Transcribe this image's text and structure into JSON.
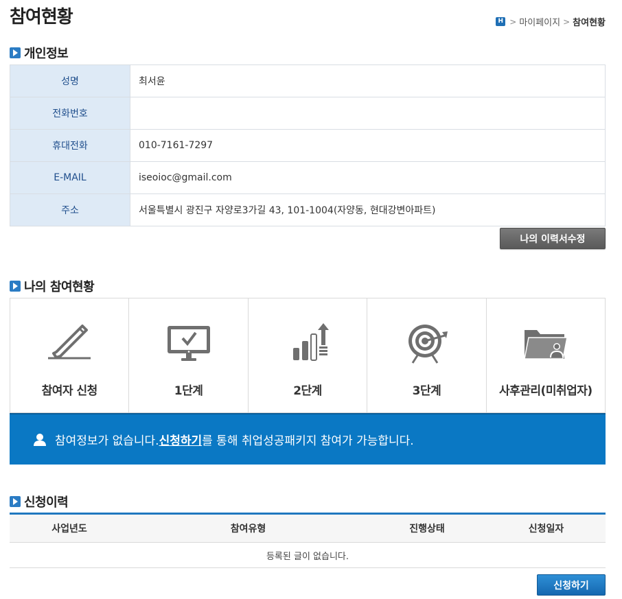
{
  "page": {
    "title": "참여현황"
  },
  "breadcrumb": {
    "home_icon": "H",
    "items": [
      "마이페이지",
      "참여현황"
    ],
    "sep": ">"
  },
  "personal": {
    "title": "개인정보",
    "rows": [
      {
        "label": "성명",
        "value": "최서윤"
      },
      {
        "label": "전화번호",
        "value": ""
      },
      {
        "label": "휴대전화",
        "value": "010-7161-7297"
      },
      {
        "label": "E-MAIL",
        "value": "iseoioc@gmail.com"
      },
      {
        "label": "주소",
        "value": "서울특별시 광진구 자양로3가길 43, 101-1004(자양동, 현대강변아파트)"
      }
    ],
    "edit_button": "나의 이력서수정"
  },
  "participation": {
    "title": "나의 참여현황",
    "steps": [
      {
        "label": "참여자 신청",
        "icon": "pencil-icon"
      },
      {
        "label": "1단계",
        "icon": "monitor-check-icon"
      },
      {
        "label": "2단계",
        "icon": "bar-growth-icon"
      },
      {
        "label": "3단계",
        "icon": "target-icon"
      },
      {
        "label": "사후관리(미취업자)",
        "icon": "folder-user-icon"
      }
    ],
    "notice": {
      "prefix": "참여정보가 없습니다. ",
      "link": "신청하기",
      "suffix": "를 통해 취업성공패키지 참여가 가능합니다."
    }
  },
  "history": {
    "title": "신청이력",
    "columns": [
      "사업년도",
      "참여유형",
      "진행상태",
      "신청일자"
    ],
    "empty_message": "등록된 글이 없습니다.",
    "apply_button": "신청하기"
  },
  "colors": {
    "accent": "#0a78c4",
    "label_bg": "#deeaf6",
    "label_text": "#1f4e8c"
  }
}
